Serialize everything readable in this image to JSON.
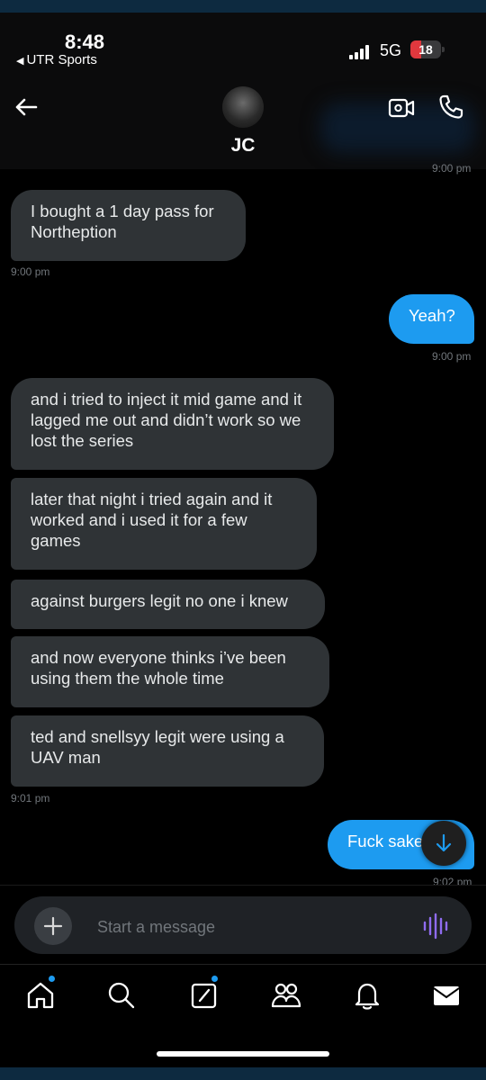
{
  "status": {
    "time": "8:48",
    "back_app": "UTR Sports",
    "network": "5G",
    "battery": "18"
  },
  "header": {
    "contact_name": "JC"
  },
  "thread": {
    "clipped_timestamp": "9:00 pm",
    "messages": [
      {
        "text": "I bought a 1 day pass for Northeption",
        "dir": "in"
      },
      {
        "time": "9:00 pm"
      },
      {
        "text": "Yeah?",
        "dir": "out"
      },
      {
        "time": "9:00 pm"
      },
      {
        "text": "and i tried to inject it mid game and it lagged me out and didn’t work so we lost the series",
        "dir": "in"
      },
      {
        "text": "later that night i tried again and it worked and i used it for a few games",
        "dir": "in"
      },
      {
        "text": "against burgers legit no one i knew",
        "dir": "in"
      },
      {
        "text": "and now everyone thinks i’ve been using them the whole time",
        "dir": "in"
      },
      {
        "text": "ted and snellsyy legit were using a UAV man",
        "dir": "in"
      },
      {
        "time": "9:01 pm"
      },
      {
        "text": "Fuck sake",
        "dir": "out"
      },
      {
        "time": "9:02 pm"
      }
    ]
  },
  "composer": {
    "placeholder": "Start a message"
  },
  "tabs": [
    "home",
    "search",
    "compose",
    "communities",
    "notifications",
    "messages"
  ],
  "colors": {
    "accent": "#1d9bf0",
    "incoming_bubble": "#2f3336",
    "voice_icon": "#8f6cf0"
  }
}
